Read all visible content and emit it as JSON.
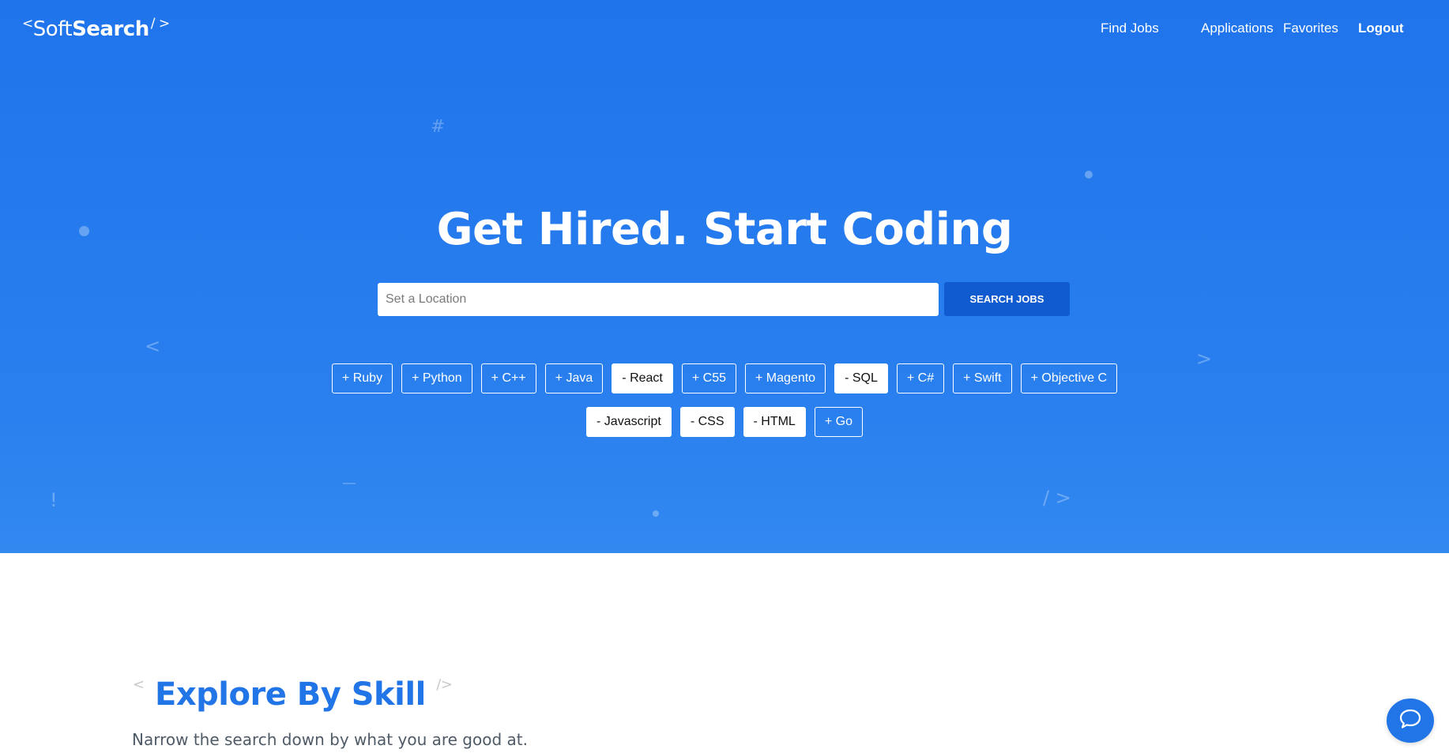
{
  "brand": {
    "open": "<",
    "soft": "Soft",
    "search": "Search",
    "close": "/ >"
  },
  "nav": {
    "find_jobs": "Find Jobs",
    "applications": "Applications",
    "favorites": "Favorites",
    "logout": "Logout"
  },
  "hero": {
    "headline": "Get Hired. Start Coding",
    "placeholder": "Set a Location",
    "search_button": "SEARCH JOBS",
    "decorations": {
      "hash": "#",
      "lt": "<",
      "gt": ">",
      "bang": "!",
      "dash": "—",
      "slash_gt": "/ >"
    }
  },
  "skills_row1": [
    {
      "label": "+ Ruby",
      "selected": false
    },
    {
      "label": "+ Python",
      "selected": false
    },
    {
      "label": "+ C++",
      "selected": false
    },
    {
      "label": "+ Java",
      "selected": false
    },
    {
      "label": "- React",
      "selected": true
    },
    {
      "label": "+ C55",
      "selected": false
    },
    {
      "label": "+ Magento",
      "selected": false
    },
    {
      "label": "- SQL",
      "selected": true
    },
    {
      "label": "+ C#",
      "selected": false
    },
    {
      "label": "+ Swift",
      "selected": false
    },
    {
      "label": "+ Objective C",
      "selected": false
    }
  ],
  "skills_row2": [
    {
      "label": "- Javascript",
      "selected": true
    },
    {
      "label": "- CSS",
      "selected": true
    },
    {
      "label": "- HTML",
      "selected": true
    },
    {
      "label": "+ Go",
      "selected": false
    }
  ],
  "explore": {
    "open": "<",
    "title": "Explore By Skill",
    "close": "/>",
    "subtitle": "Narrow the search down by what you are good at."
  },
  "colors": {
    "hero_blue": "#1f74ec",
    "button_blue": "#0f5bcf",
    "accent": "#2275e6"
  },
  "icons": {
    "chat": "chat-bubble-icon"
  }
}
